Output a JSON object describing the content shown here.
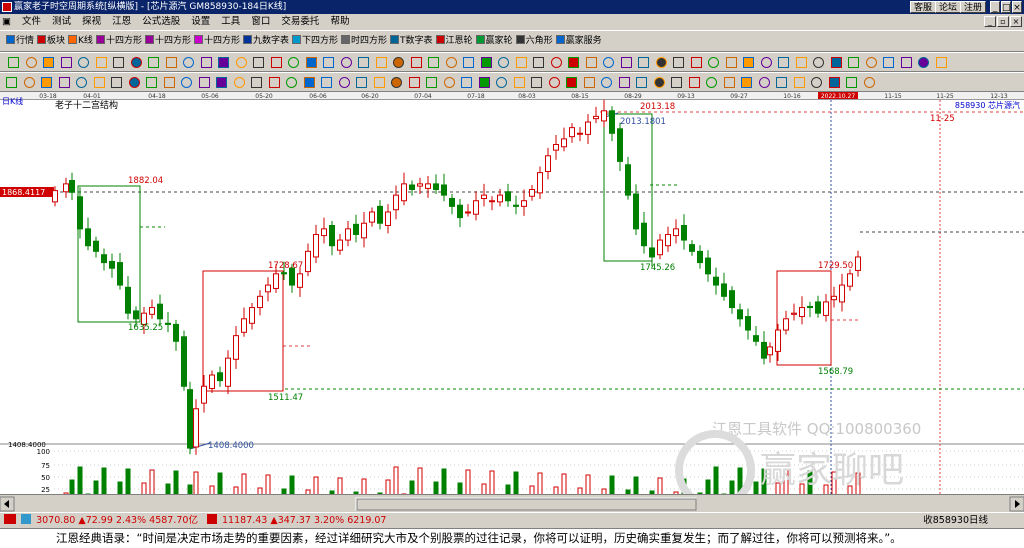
{
  "window": {
    "title": "赢家老子时空周期系统[纵横版] - [芯片源汽   GM858930-184日K线]",
    "btn_help": "客服",
    "btn_forum": "论坛",
    "btn_register": "注册"
  },
  "menu": [
    "文件",
    "测试",
    "探视",
    "江恩",
    "公式选股",
    "设置",
    "工具",
    "窗口",
    "交易委托",
    "帮助"
  ],
  "toolbar1": [
    "行情",
    "板块",
    "K线",
    "十四方形",
    "十四方形",
    "十四方形",
    "九数字表",
    "下四方形",
    "时四方形",
    "T数字表",
    "江恩轮",
    "赢家轮",
    "六角形",
    "赢家服务"
  ],
  "colors": {
    "titlebar": "#0a246a",
    "up": "#d00000",
    "down": "#008000",
    "frame_red": "#d00000",
    "frame_green": "#008000",
    "cursor": "#3050a0"
  },
  "chart": {
    "period_label": "日K线",
    "study_label": "老子十二宫结构",
    "symbol": "858930 芯片源汽",
    "date_ticks": [
      "03-18",
      "04-01",
      "04-18",
      "05-06",
      "05-20",
      "06-06",
      "06-20",
      "07-04",
      "07-18",
      "08-03",
      "08-15",
      "08-29",
      "09-13",
      "09-27",
      "10-16",
      "2022.10.27",
      "11-15",
      "11-25",
      "12-13"
    ],
    "cursor_date": "2022.10.27",
    "cursor_price_label": "1868.4117",
    "bottom_price_label": "1408.4000",
    "vol_ticks": [
      "100",
      "75",
      "50",
      "25"
    ],
    "annotations": [
      "1882.04",
      "1635.25",
      "1728.67",
      "1511.47",
      "1408.4000",
      "2013.18",
      "2013.1801",
      "1745.26",
      "1729.50",
      "1568.79",
      "11-25"
    ],
    "watermark": [
      "江恩工具软件  QQ:100800360",
      "赢家聊吧",
      "jiaoba.yj.com"
    ]
  },
  "status": {
    "idx1": "3070.80",
    "chg1": "▲72.99",
    "pct1": "2.43%",
    "amt1": "4587.70亿",
    "idx2": "11187.43",
    "chg2": "▲347.37",
    "pct2": "3.20%",
    "amt2": "6219.07",
    "right": "收858930日线"
  },
  "quote": "江恩经典语录：“时间是决定市场走势的重要因素，经过详细研究大市及个别股票的过往记录，你将可以证明，历史确实重复发生；而了解过往，你将可以预测将来。”。"
}
